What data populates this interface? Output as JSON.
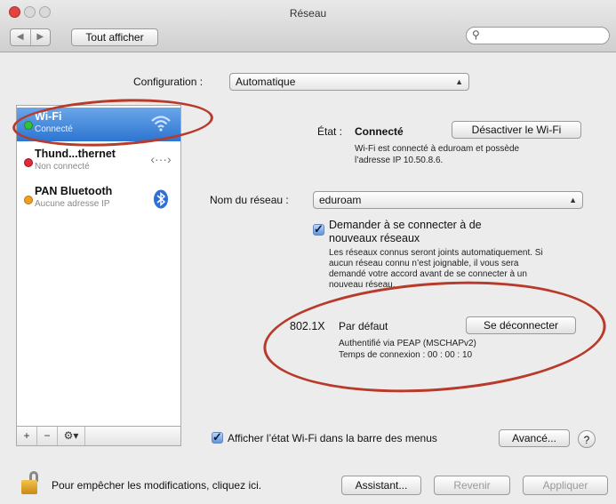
{
  "window": {
    "title": "Réseau",
    "show_all_label": "Tout afficher",
    "nav_back": "◀",
    "nav_forward": "▶",
    "search_placeholder": ""
  },
  "configuration": {
    "label": "Configuration :",
    "value": "Automatique"
  },
  "sidebar": {
    "items": [
      {
        "name": "Wi-Fi",
        "status": "Connecté",
        "dot_color": "#34c03a",
        "icon": "wifi-icon"
      },
      {
        "name": "Thund...thernet",
        "status": "Non connecté",
        "dot_color": "#e0293b",
        "icon": "ethernet-icon"
      },
      {
        "name": "PAN Bluetooth",
        "status": "Aucune adresse IP",
        "dot_color": "#f0a020",
        "icon": "bluetooth-icon"
      }
    ],
    "add": "+",
    "remove": "−",
    "gear": "⚙▾"
  },
  "status": {
    "label": "État :",
    "value": "Connecté",
    "disable_button": "Désactiver le Wi-Fi",
    "description_1": "Wi-Fi est connecté à eduroam et possède",
    "description_2": "l’adresse IP 10.50.8.6."
  },
  "network": {
    "label": "Nom du réseau :",
    "value": "eduroam"
  },
  "ask_join": {
    "label_1": "Demander à se connecter à de",
    "label_2": "nouveaux réseaux",
    "desc_1": "Les réseaux connus seront joints automatiquement. Si",
    "desc_2": "aucun réseau connu n’est joignable, il vous sera",
    "desc_3": "demandé votre accord avant de se connecter à un",
    "desc_4": "nouveau réseau."
  },
  "dot1x": {
    "label": "802.1X",
    "value": "Par défaut",
    "disconnect_button": "Se déconnecter",
    "auth": "Authentifié via PEAP (MSCHAPv2)",
    "time": "Temps de connexion : 00 : 00 : 10"
  },
  "show_status": {
    "label": "Afficher l’état Wi-Fi dans la barre des menus"
  },
  "advanced_button": "Avancé...",
  "help": "?",
  "footer": {
    "lock_text": "Pour empêcher les modifications, cliquez ici.",
    "assistant": "Assistant...",
    "revert": "Revenir",
    "apply": "Appliquer"
  },
  "colors": {
    "accent": "#2d75d2",
    "annotation": "#b83a2a"
  }
}
